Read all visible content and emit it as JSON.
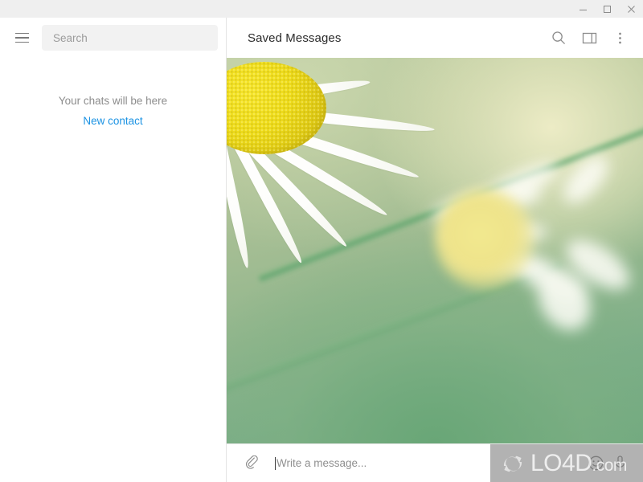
{
  "titlebar": {
    "minimize_label": "minimize",
    "maximize_label": "maximize",
    "close_label": "close"
  },
  "sidebar": {
    "menu_icon": "hamburger-menu-icon",
    "search": {
      "placeholder": "Search",
      "value": ""
    },
    "empty_state": {
      "message": "Your chats will be here",
      "action_label": "New contact",
      "action_color": "#1c93e3"
    }
  },
  "chat": {
    "title": "Saved Messages",
    "actions": [
      {
        "name": "search-icon",
        "label": "Search"
      },
      {
        "name": "panel-toggle-icon",
        "label": "Toggle info panel"
      },
      {
        "name": "more-menu-icon",
        "label": "More"
      }
    ],
    "wallpaper": {
      "description": "daisy flower photo",
      "colors": {
        "green": "#8fb58c",
        "cream": "#e4e6bc",
        "stem_green": "#489860",
        "petal_white": "#ffffff",
        "center_yellow": "#eedc1c"
      }
    },
    "composer": {
      "attach_icon": "paperclip-icon",
      "placeholder": "Write a message...",
      "value": "",
      "emoji_icon": "smiley-icon",
      "mic_icon": "microphone-icon"
    }
  },
  "watermark": {
    "text": "LO4D",
    "suffix": ".com"
  }
}
